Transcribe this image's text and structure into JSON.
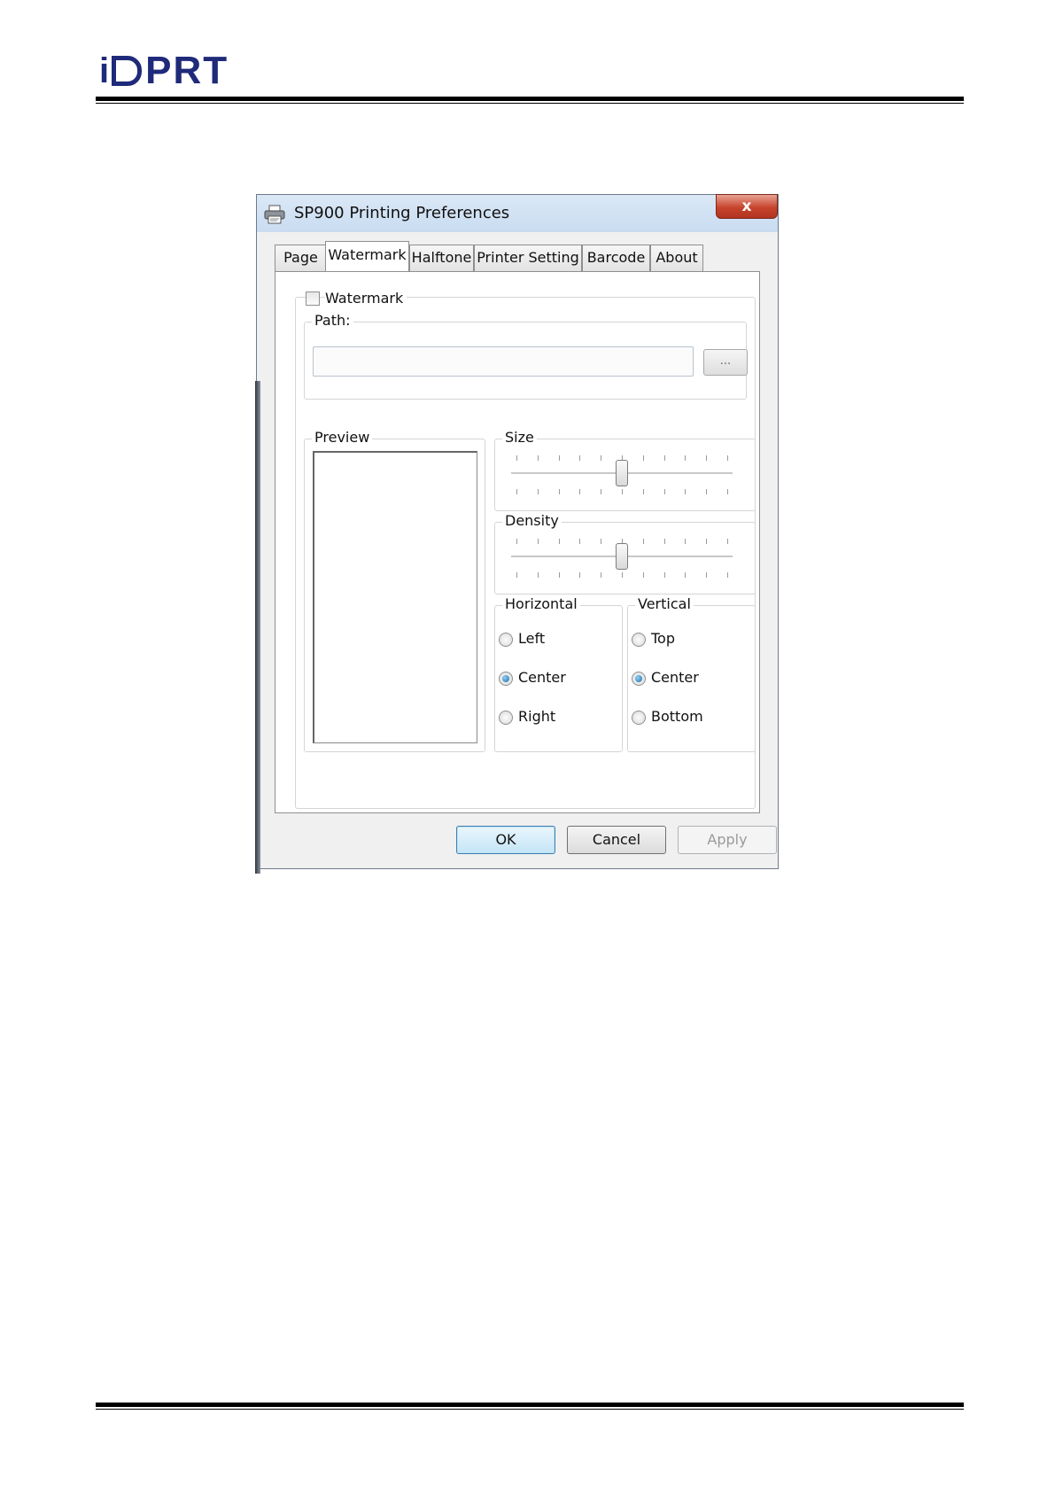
{
  "document": {
    "logo": {
      "i": "i",
      "rest": "PRT"
    }
  },
  "dialog": {
    "title": "SP900 Printing Preferences",
    "close_label": "x",
    "tabs": [
      {
        "label": "Page",
        "active": false
      },
      {
        "label": "Watermark",
        "active": true
      },
      {
        "label": "Halftone",
        "active": false
      },
      {
        "label": "Printer Setting",
        "active": false
      },
      {
        "label": "Barcode",
        "active": false
      },
      {
        "label": "About",
        "active": false
      }
    ],
    "watermark": {
      "checkbox_label": "Watermark",
      "checked": false,
      "path_label": "Path:",
      "path_value": "",
      "browse_label": "..."
    },
    "preview": {
      "label": "Preview"
    },
    "size": {
      "label": "Size",
      "value": 0.5,
      "ticks": 11
    },
    "density": {
      "label": "Density",
      "value": 0.5,
      "ticks": 11
    },
    "horizontal": {
      "label": "Horizontal",
      "options": [
        "Left",
        "Center",
        "Right"
      ],
      "selected": "Center"
    },
    "vertical": {
      "label": "Vertical",
      "options": [
        "Top",
        "Center",
        "Bottom"
      ],
      "selected": "Center"
    },
    "buttons": {
      "ok": "OK",
      "cancel": "Cancel",
      "apply": "Apply"
    }
  }
}
